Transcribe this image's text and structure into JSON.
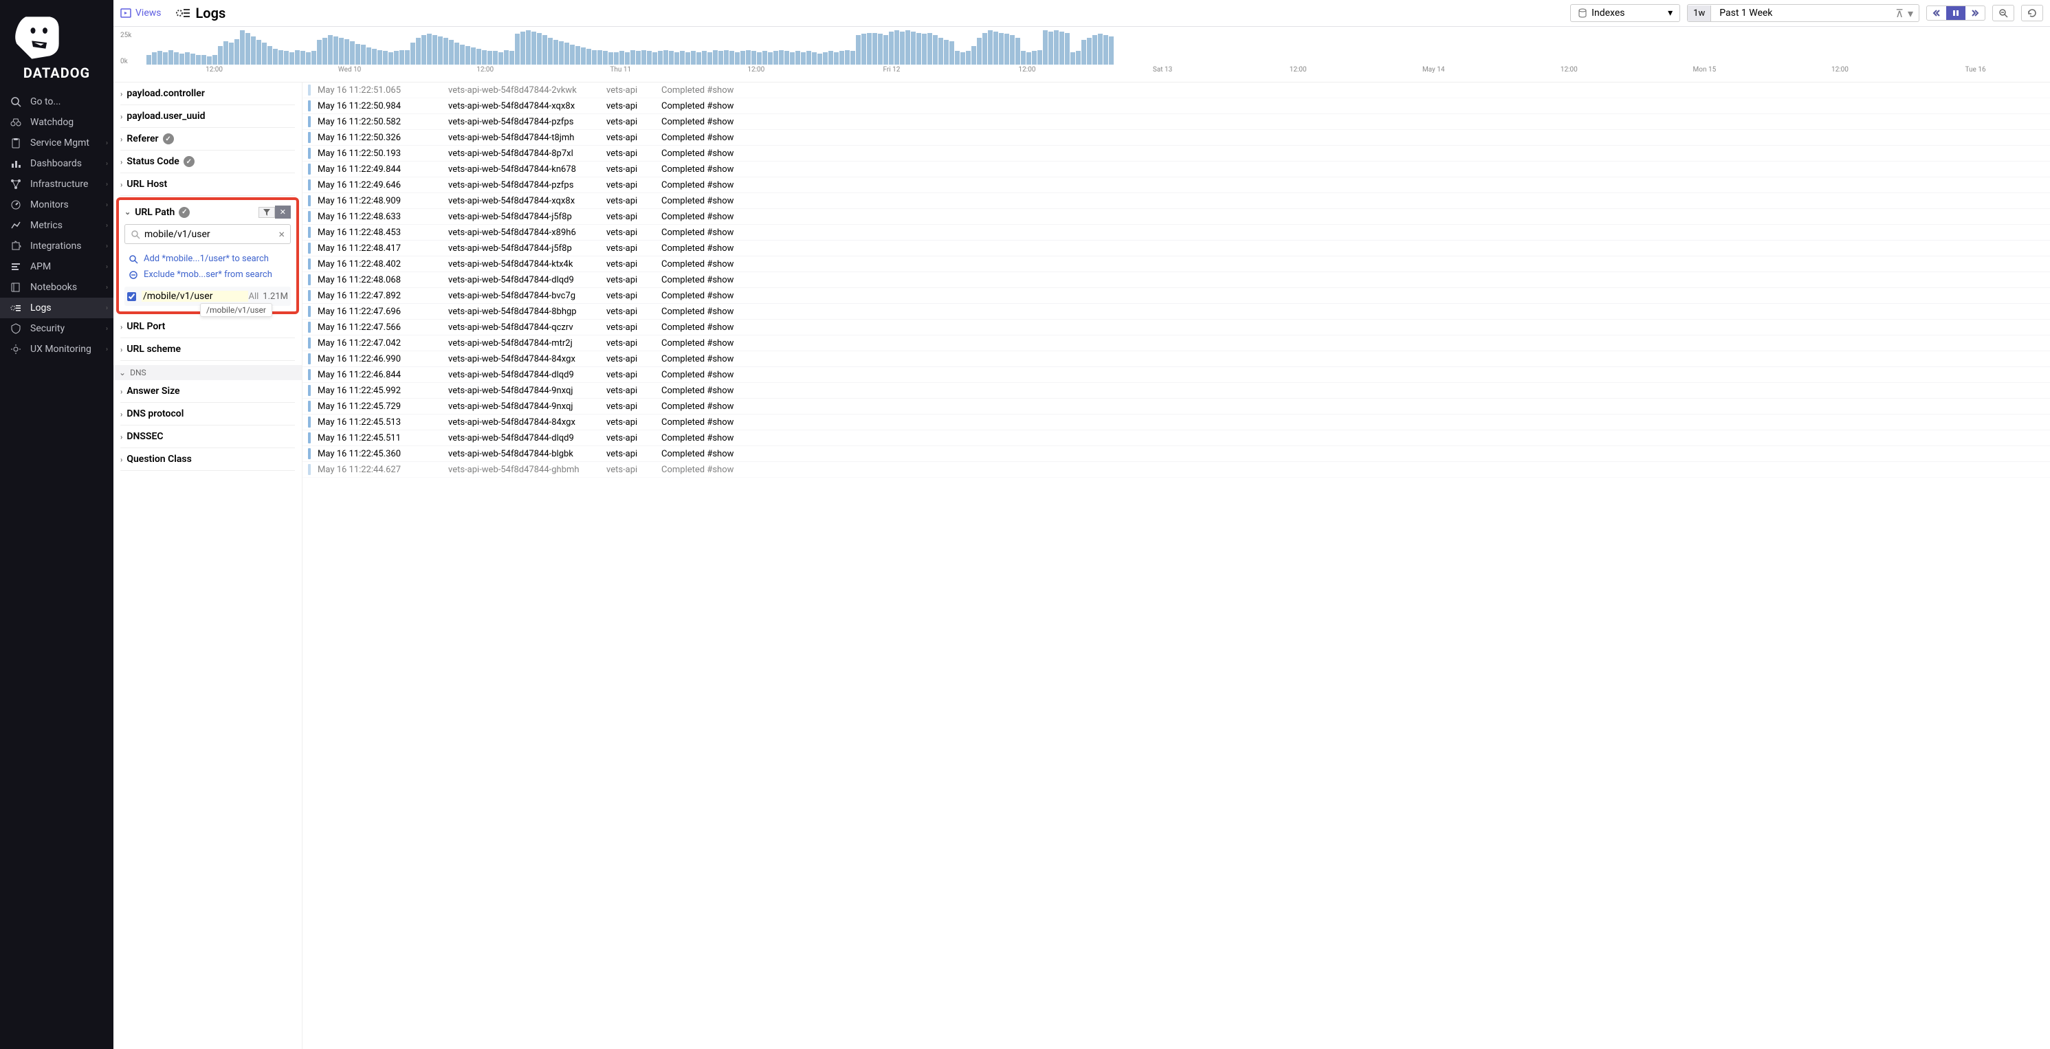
{
  "brand": "DATADOG",
  "sidebarItems": [
    {
      "label": "Go to...",
      "icon": "search",
      "chevron": false
    },
    {
      "label": "Watchdog",
      "icon": "binoculars",
      "chevron": false
    },
    {
      "label": "Service Mgmt",
      "icon": "clipboard",
      "chevron": true
    },
    {
      "label": "Dashboards",
      "icon": "bars",
      "chevron": true
    },
    {
      "label": "Infrastructure",
      "icon": "nodes",
      "chevron": true
    },
    {
      "label": "Monitors",
      "icon": "gauge",
      "chevron": true
    },
    {
      "label": "Metrics",
      "icon": "chart",
      "chevron": true
    },
    {
      "label": "Integrations",
      "icon": "puzzle",
      "chevron": true
    },
    {
      "label": "APM",
      "icon": "segments",
      "chevron": true
    },
    {
      "label": "Notebooks",
      "icon": "book",
      "chevron": true
    },
    {
      "label": "Logs",
      "icon": "logs",
      "chevron": true,
      "active": true
    },
    {
      "label": "Security",
      "icon": "shield",
      "chevron": true
    },
    {
      "label": "UX Monitoring",
      "icon": "sun",
      "chevron": true
    }
  ],
  "header": {
    "viewsLabel": "Views",
    "title": "Logs",
    "indexesLabel": "Indexes",
    "timeChip": "1w",
    "timeLabel": "Past 1 Week"
  },
  "chart_data": {
    "type": "bar",
    "ylabel": "",
    "ylim": [
      0,
      25000
    ],
    "yTicks": [
      "25k",
      "0k"
    ],
    "xTicks": [
      "12:00",
      "Wed 10",
      "12:00",
      "Thu 11",
      "12:00",
      "Fri 12",
      "12:00",
      "Sat 13",
      "12:00",
      "May 14",
      "12:00",
      "Mon 15",
      "12:00",
      "Tue 16"
    ],
    "values": [
      8,
      10,
      11,
      10,
      12,
      10,
      9,
      10,
      9,
      8,
      8,
      7,
      8,
      15,
      19,
      18,
      21,
      28,
      26,
      23,
      20,
      18,
      15,
      13,
      12,
      11,
      10,
      12,
      11,
      10,
      11,
      20,
      22,
      24,
      23,
      22,
      21,
      19,
      17,
      16,
      14,
      13,
      12,
      11,
      10,
      11,
      12,
      12,
      18,
      22,
      24,
      25,
      24,
      23,
      22,
      20,
      18,
      16,
      15,
      14,
      13,
      12,
      11,
      11,
      10,
      12,
      11,
      25,
      27,
      28,
      27,
      26,
      24,
      22,
      20,
      19,
      18,
      16,
      15,
      14,
      13,
      12,
      12,
      11,
      10,
      10,
      11,
      10,
      12,
      11,
      12,
      11,
      10,
      11,
      12,
      11,
      10,
      11,
      10,
      11,
      10,
      11,
      10,
      12,
      11,
      12,
      11,
      10,
      11,
      12,
      11,
      10,
      11,
      10,
      11,
      12,
      11,
      10,
      11,
      10,
      11,
      10,
      9,
      10,
      11,
      10,
      11,
      12,
      11,
      24,
      25,
      26,
      26,
      25,
      24,
      27,
      28,
      27,
      28,
      27,
      26,
      25,
      26,
      24,
      22,
      20,
      19,
      11,
      10,
      11,
      15,
      22,
      26,
      28,
      27,
      26,
      25,
      24,
      22,
      11,
      10,
      11,
      12,
      28,
      27,
      28,
      27,
      26,
      10,
      11,
      20,
      22,
      24,
      25,
      24,
      23
    ]
  },
  "facets": {
    "simpleGroups": [
      "payload.controller",
      "payload.user_uuid"
    ],
    "badgedGroups1": [
      "Referer",
      "Status Code"
    ],
    "simpleGroup2": "URL Host",
    "urlPath": {
      "label": "URL Path",
      "searchValue": "mobile/v1/user",
      "addSuggestion": "Add *mobile...1/user* to search",
      "excludeSuggestion": "Exclude *mob...ser* from search",
      "valueText": "/mobile/v1/user",
      "allLabel": "All",
      "countLabel": "1.21M",
      "tooltip": "/mobile/v1/user"
    },
    "afterGroups": [
      "URL Port",
      "URL scheme"
    ],
    "dnsHeader": "DNS",
    "dnsGroups": [
      "Answer Size",
      "DNS protocol",
      "DNSSEC",
      "Question Class"
    ]
  },
  "logs": [
    {
      "ts": "May 16 11:22:51.065",
      "host": "vets-api-web-54f8d47844-2vkwk",
      "svc": "vets-api",
      "msg": "Completed #show",
      "cut": true
    },
    {
      "ts": "May 16 11:22:50.984",
      "host": "vets-api-web-54f8d47844-xqx8x",
      "svc": "vets-api",
      "msg": "Completed #show"
    },
    {
      "ts": "May 16 11:22:50.582",
      "host": "vets-api-web-54f8d47844-pzfps",
      "svc": "vets-api",
      "msg": "Completed #show"
    },
    {
      "ts": "May 16 11:22:50.326",
      "host": "vets-api-web-54f8d47844-t8jmh",
      "svc": "vets-api",
      "msg": "Completed #show"
    },
    {
      "ts": "May 16 11:22:50.193",
      "host": "vets-api-web-54f8d47844-8p7xl",
      "svc": "vets-api",
      "msg": "Completed #show"
    },
    {
      "ts": "May 16 11:22:49.844",
      "host": "vets-api-web-54f8d47844-kn678",
      "svc": "vets-api",
      "msg": "Completed #show"
    },
    {
      "ts": "May 16 11:22:49.646",
      "host": "vets-api-web-54f8d47844-pzfps",
      "svc": "vets-api",
      "msg": "Completed #show"
    },
    {
      "ts": "May 16 11:22:48.909",
      "host": "vets-api-web-54f8d47844-xqx8x",
      "svc": "vets-api",
      "msg": "Completed #show"
    },
    {
      "ts": "May 16 11:22:48.633",
      "host": "vets-api-web-54f8d47844-j5f8p",
      "svc": "vets-api",
      "msg": "Completed #show"
    },
    {
      "ts": "May 16 11:22:48.453",
      "host": "vets-api-web-54f8d47844-x89h6",
      "svc": "vets-api",
      "msg": "Completed #show"
    },
    {
      "ts": "May 16 11:22:48.417",
      "host": "vets-api-web-54f8d47844-j5f8p",
      "svc": "vets-api",
      "msg": "Completed #show"
    },
    {
      "ts": "May 16 11:22:48.402",
      "host": "vets-api-web-54f8d47844-ktx4k",
      "svc": "vets-api",
      "msg": "Completed #show"
    },
    {
      "ts": "May 16 11:22:48.068",
      "host": "vets-api-web-54f8d47844-dlqd9",
      "svc": "vets-api",
      "msg": "Completed #show"
    },
    {
      "ts": "May 16 11:22:47.892",
      "host": "vets-api-web-54f8d47844-bvc7g",
      "svc": "vets-api",
      "msg": "Completed #show"
    },
    {
      "ts": "May 16 11:22:47.696",
      "host": "vets-api-web-54f8d47844-8bhgp",
      "svc": "vets-api",
      "msg": "Completed #show"
    },
    {
      "ts": "May 16 11:22:47.566",
      "host": "vets-api-web-54f8d47844-qczrv",
      "svc": "vets-api",
      "msg": "Completed #show"
    },
    {
      "ts": "May 16 11:22:47.042",
      "host": "vets-api-web-54f8d47844-mtr2j",
      "svc": "vets-api",
      "msg": "Completed #show"
    },
    {
      "ts": "May 16 11:22:46.990",
      "host": "vets-api-web-54f8d47844-84xgx",
      "svc": "vets-api",
      "msg": "Completed #show"
    },
    {
      "ts": "May 16 11:22:46.844",
      "host": "vets-api-web-54f8d47844-dlqd9",
      "svc": "vets-api",
      "msg": "Completed #show"
    },
    {
      "ts": "May 16 11:22:45.992",
      "host": "vets-api-web-54f8d47844-9nxqj",
      "svc": "vets-api",
      "msg": "Completed #show"
    },
    {
      "ts": "May 16 11:22:45.729",
      "host": "vets-api-web-54f8d47844-9nxqj",
      "svc": "vets-api",
      "msg": "Completed #show"
    },
    {
      "ts": "May 16 11:22:45.513",
      "host": "vets-api-web-54f8d47844-84xgx",
      "svc": "vets-api",
      "msg": "Completed #show"
    },
    {
      "ts": "May 16 11:22:45.511",
      "host": "vets-api-web-54f8d47844-dlqd9",
      "svc": "vets-api",
      "msg": "Completed #show"
    },
    {
      "ts": "May 16 11:22:45.360",
      "host": "vets-api-web-54f8d47844-blgbk",
      "svc": "vets-api",
      "msg": "Completed #show"
    },
    {
      "ts": "May 16 11:22:44.627",
      "host": "vets-api-web-54f8d47844-ghbmh",
      "svc": "vets-api",
      "msg": "Completed #show",
      "cut": true
    }
  ]
}
